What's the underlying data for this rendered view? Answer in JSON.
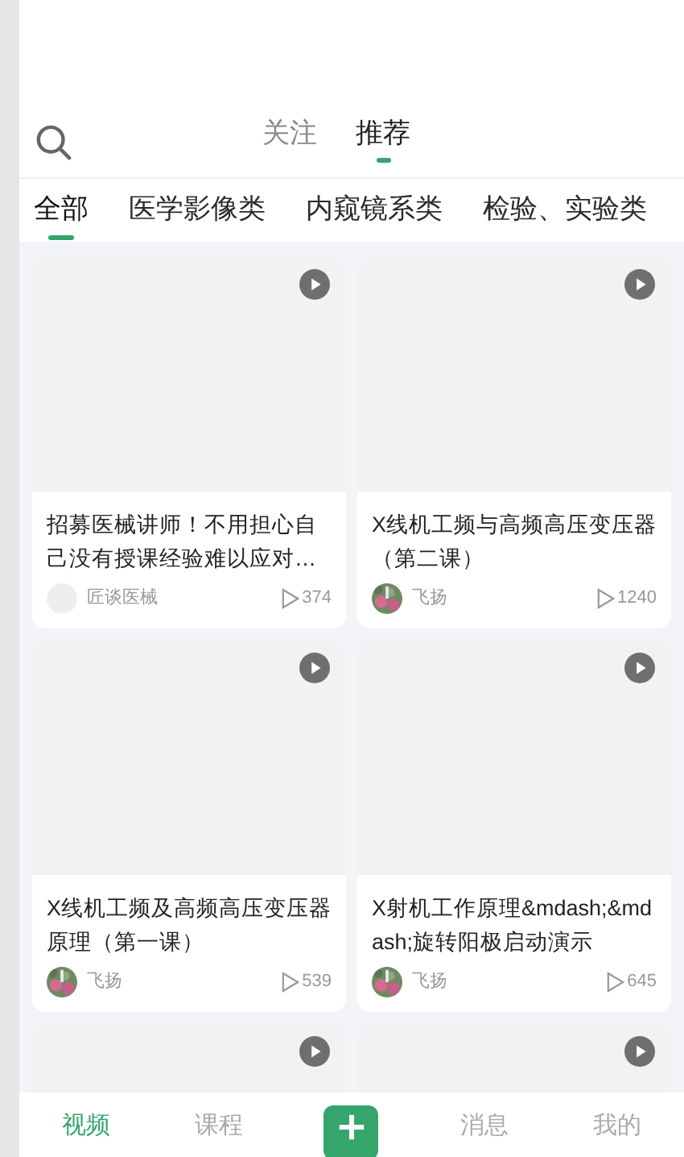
{
  "header": {
    "tabs": [
      {
        "label": "关注",
        "selected": false
      },
      {
        "label": "推荐",
        "selected": true
      }
    ]
  },
  "categories": [
    {
      "label": "全部",
      "selected": true
    },
    {
      "label": "医学影像类",
      "selected": false
    },
    {
      "label": "内窥镜系类",
      "selected": false
    },
    {
      "label": "检验、实验类",
      "selected": false
    }
  ],
  "videos": [
    {
      "kind": "video",
      "title": "招募医械讲师！不用担心自己没有授课经验难以应对…",
      "author": "匠谈医械",
      "avatar": {
        "kind": "blank"
      },
      "views": "374"
    },
    {
      "kind": "video",
      "title": "X线机工频与高频高压变压器（第二课）",
      "author": "飞扬",
      "views": "1240"
    },
    {
      "kind": "video",
      "title": "X线机工频及高频高压变压器原理（第一课）",
      "author": "飞扬",
      "views": "539"
    },
    {
      "kind": "video",
      "title": "X射机工作原理&mdash;&mdash;旋转阳极启动演示",
      "author": "飞扬",
      "views": "645"
    },
    {
      "kind": "partial"
    },
    {
      "kind": "partial"
    }
  ],
  "bottom_nav": [
    {
      "label": "视频",
      "selected": true
    },
    {
      "label": "课程",
      "selected": false
    },
    {
      "kind": "add"
    },
    {
      "label": "消息",
      "selected": false
    },
    {
      "label": "我的",
      "selected": false
    }
  ]
}
